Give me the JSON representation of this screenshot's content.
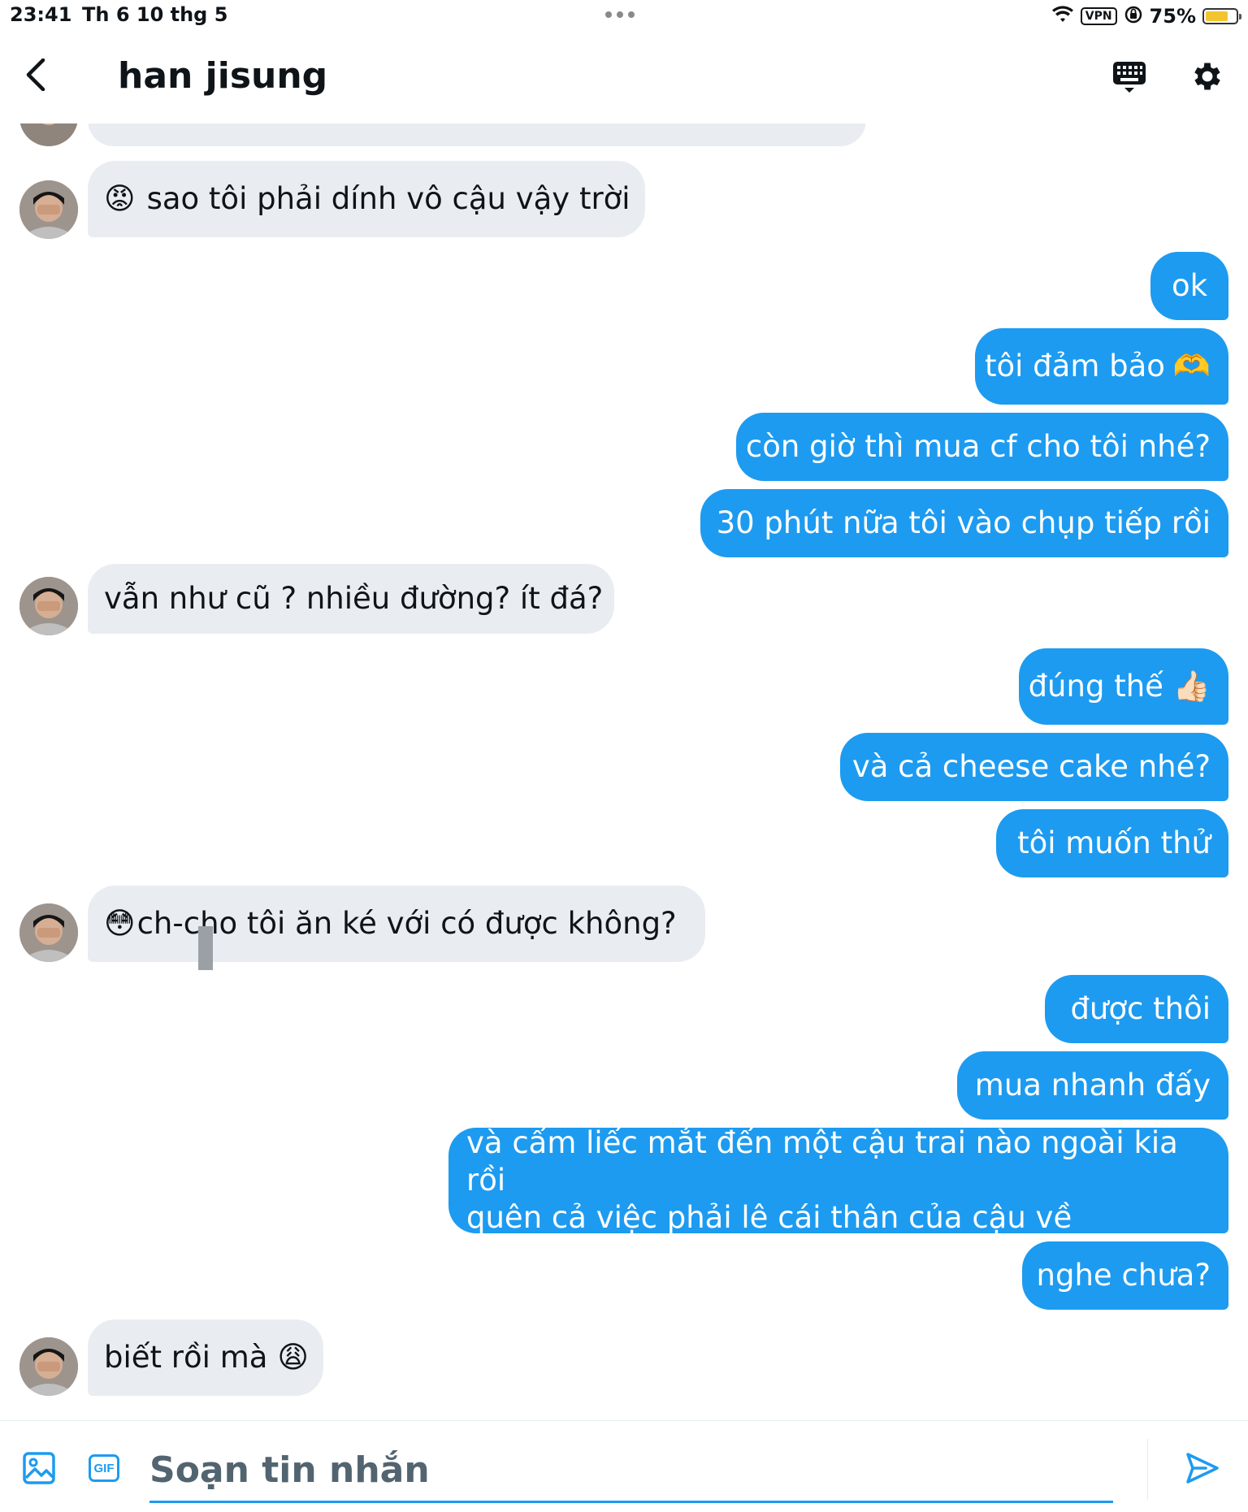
{
  "status_bar": {
    "time": "23:41",
    "date": "Th 6 10 thg 5",
    "vpn": "VPN",
    "battery_percent": "75%",
    "battery_level": 0.75
  },
  "header": {
    "title": "han jisung"
  },
  "messages": {
    "m1": {
      "text": "sao tôi phải dính vô cậu vậy trời",
      "emoji": "😡"
    },
    "m2": {
      "text": "ok"
    },
    "m3": {
      "text": "tôi đảm bảo",
      "emoji": "🫶"
    },
    "m4": {
      "text": "còn giờ thì mua cf cho tôi nhé?"
    },
    "m5": {
      "text": "30 phút nữa tôi vào chụp tiếp rồi"
    },
    "m6": {
      "text": "vẫn như cũ ? nhiều đường? ít đá?"
    },
    "m7": {
      "text": "đúng thế",
      "emoji": "👍🏻"
    },
    "m8": {
      "text": "và cả cheese cake nhé?"
    },
    "m9": {
      "text": "tôi muốn thử"
    },
    "m10": {
      "text": "ch-cho tôi ăn ké với có được không?",
      "emoji": "😳"
    },
    "m11": {
      "text": "được thôi"
    },
    "m12": {
      "text": "mua nhanh đấy"
    },
    "m13": {
      "line1": "và cấm liếc mắt đến một cậu trai nào ngoài kia rồi",
      "line2": "quên cả việc phải lê cái thân của cậu về"
    },
    "m14": {
      "text": "nghe chưa?"
    },
    "m15": {
      "text": "biết rồi mà",
      "emoji": "😩"
    }
  },
  "composer": {
    "placeholder": "Soạn tin nhắn",
    "gif_label": "GIF"
  },
  "colors": {
    "accent": "#1d9bf0",
    "incoming_bubble": "#e9edf1",
    "text": "#0f1419",
    "muted": "#536471"
  }
}
